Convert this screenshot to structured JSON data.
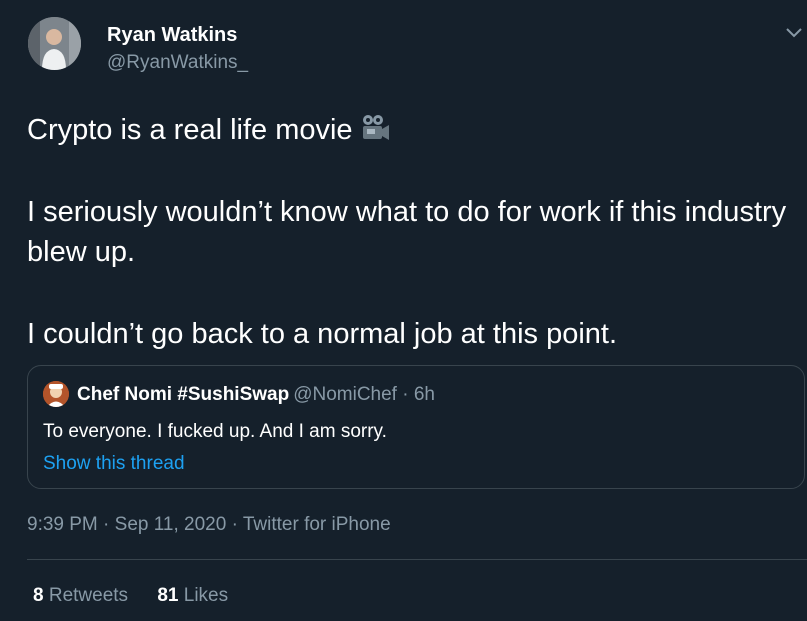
{
  "author": {
    "name": "Ryan Watkins",
    "handle": "@RyanWatkins_",
    "avatar_icon": "profile-photo"
  },
  "tweet": {
    "lines": [
      "Crypto is a real life movie",
      "I seriously wouldn’t know what to do for work if this industry blew up.",
      "I couldn’t go back to a normal job at this point."
    ],
    "emoji_icon": "movie-camera-icon"
  },
  "quoted_tweet": {
    "name": "Chef Nomi #SushiSwap",
    "handle_time": "@NomiChef · 6h",
    "text": "To everyone. I fucked up. And I am sorry.",
    "show_thread_label": "Show this thread"
  },
  "meta": {
    "time": "9:39 PM",
    "date": "Sep 11, 2020",
    "source": "Twitter for iPhone",
    "separator": " · "
  },
  "stats": {
    "retweets_count": "8",
    "retweets_label": "Retweets",
    "likes_count": "81",
    "likes_label": "Likes"
  },
  "colors": {
    "background": "#15202b",
    "text": "#ffffff",
    "secondary": "#8899a6",
    "link": "#1da1f2",
    "border": "#38444d"
  }
}
